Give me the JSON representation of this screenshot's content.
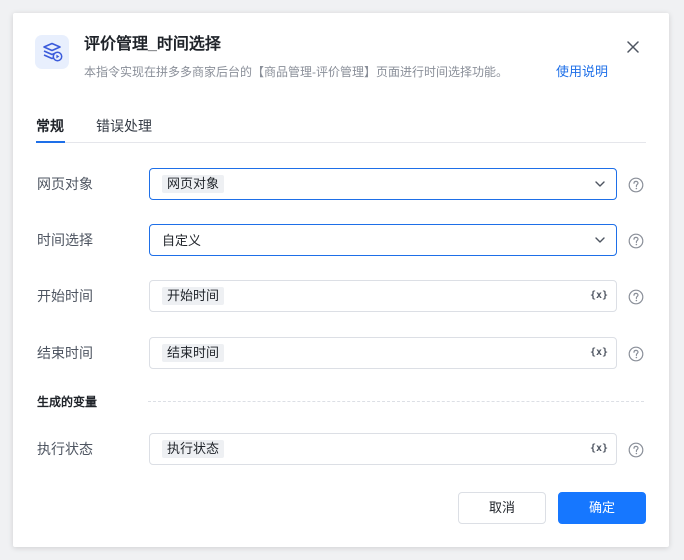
{
  "dialog": {
    "title": "评价管理_时间选择",
    "description": "本指令实现在拼多多商家后台的【商品管理-评价管理】页面进行时间选择功能。",
    "help_link": "使用说明",
    "icon": "layers-play-icon"
  },
  "tabs": [
    {
      "label": "常规",
      "active": true
    },
    {
      "label": "错误处理",
      "active": false
    }
  ],
  "fields": {
    "web_object": {
      "label": "网页对象",
      "value": "网页对象"
    },
    "time_select": {
      "label": "时间选择",
      "value": "自定义"
    },
    "start_time": {
      "label": "开始时间",
      "value": "开始时间",
      "var_icon": "{x}"
    },
    "end_time": {
      "label": "结束时间",
      "value": "结束时间",
      "var_icon": "{x}"
    }
  },
  "output_section": {
    "title": "生成的变量",
    "exec_status": {
      "label": "执行状态",
      "value": "执行状态",
      "var_icon": "{x}"
    }
  },
  "buttons": {
    "cancel": "取消",
    "ok": "确定"
  },
  "colors": {
    "accent": "#1677ff",
    "link": "#1e6fe8",
    "border": "#dcdfe5"
  }
}
